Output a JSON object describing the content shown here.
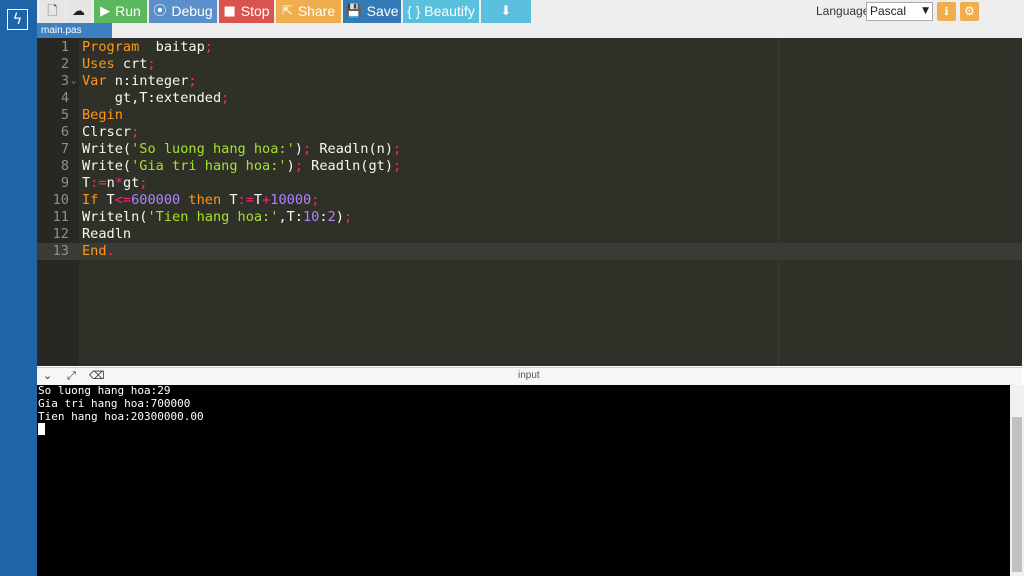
{
  "toolbar": {
    "new_icon": "🗋",
    "upload_icon": "☁",
    "run_label": "Run",
    "run_icon": "▶",
    "debug_label": "Debug",
    "debug_icon": "⦿",
    "stop_label": "Stop",
    "stop_icon": "■",
    "share_label": "Share",
    "share_icon": "⇱",
    "save_label": "Save",
    "save_icon": "💾",
    "beautify_label": "{ } Beautify",
    "download_icon": "⬇",
    "language_label": "Language",
    "language_value": "Pascal",
    "info_icon": "ℹ",
    "settings_icon": "⚙"
  },
  "tabs": [
    {
      "label": "main.pas",
      "active": true
    }
  ],
  "editor": {
    "active_line": 13,
    "lines": [
      {
        "n": "1",
        "fold": "",
        "tokens": [
          [
            "kw",
            "Program"
          ],
          [
            "",
            "  baitap"
          ],
          [
            "punc",
            ";"
          ]
        ]
      },
      {
        "n": "2",
        "fold": "",
        "tokens": [
          [
            "kw",
            "Uses"
          ],
          [
            "",
            " crt"
          ],
          [
            "punc",
            ";"
          ]
        ]
      },
      {
        "n": "3",
        "fold": "⌄",
        "tokens": [
          [
            "kw",
            "Var"
          ],
          [
            "",
            " n:integer"
          ],
          [
            "punc",
            ";"
          ]
        ]
      },
      {
        "n": "4",
        "fold": "",
        "tokens": [
          [
            "",
            "    gt,T:extended"
          ],
          [
            "punc",
            ";"
          ]
        ]
      },
      {
        "n": "5",
        "fold": "",
        "tokens": [
          [
            "kw",
            "Begin"
          ]
        ]
      },
      {
        "n": "6",
        "fold": "",
        "tokens": [
          [
            "",
            "Clrscr"
          ],
          [
            "punc",
            ";"
          ]
        ]
      },
      {
        "n": "7",
        "fold": "",
        "tokens": [
          [
            "",
            "Write("
          ],
          [
            "str",
            "'So luong hang hoa:'"
          ],
          [
            "",
            ")"
          ],
          [
            "punc",
            ";"
          ],
          [
            "",
            " Readln(n)"
          ],
          [
            "punc",
            ";"
          ]
        ]
      },
      {
        "n": "8",
        "fold": "",
        "tokens": [
          [
            "",
            "Write("
          ],
          [
            "str",
            "'Gia tri hang hoa:'"
          ],
          [
            "",
            ")"
          ],
          [
            "punc",
            ";"
          ],
          [
            "",
            " Readln(gt)"
          ],
          [
            "punc",
            ";"
          ]
        ]
      },
      {
        "n": "9",
        "fold": "",
        "tokens": [
          [
            "",
            "T"
          ],
          [
            "op",
            ":="
          ],
          [
            "",
            "n"
          ],
          [
            "op",
            "*"
          ],
          [
            "",
            "gt"
          ],
          [
            "punc",
            ";"
          ]
        ]
      },
      {
        "n": "10",
        "fold": "",
        "tokens": [
          [
            "kw",
            "If"
          ],
          [
            "",
            " T"
          ],
          [
            "op",
            "<="
          ],
          [
            "num",
            "600000"
          ],
          [
            "",
            " "
          ],
          [
            "kw",
            "then"
          ],
          [
            "",
            " T"
          ],
          [
            "op",
            ":="
          ],
          [
            "",
            "T"
          ],
          [
            "op",
            "+"
          ],
          [
            "num",
            "10000"
          ],
          [
            "punc",
            ";"
          ]
        ]
      },
      {
        "n": "11",
        "fold": "",
        "tokens": [
          [
            "",
            "Writeln("
          ],
          [
            "str",
            "'Tien hang hoa:'"
          ],
          [
            "",
            ",T:"
          ],
          [
            "num",
            "10"
          ],
          [
            "",
            ":"
          ],
          [
            "num",
            "2"
          ],
          [
            "",
            ")"
          ],
          [
            "punc",
            ";"
          ]
        ]
      },
      {
        "n": "12",
        "fold": "",
        "tokens": [
          [
            "",
            "Readln"
          ]
        ]
      },
      {
        "n": "13",
        "fold": "",
        "tokens": [
          [
            "kw",
            "End"
          ],
          [
            "punc",
            "."
          ]
        ]
      }
    ]
  },
  "output_bar": {
    "collapse_icon": "⌄",
    "expand_icon": "⤢",
    "clear_icon": "⌫",
    "input_label": "input"
  },
  "console": {
    "lines": [
      "So luong hang hoa:29",
      "Gia tri hang hoa:700000",
      "Tien hang hoa:20300000.00"
    ]
  },
  "colors": {
    "sidebar": "#1f64a8",
    "editor_bg": "#2f3129",
    "keyword": "#fd971f",
    "string": "#a6e22e",
    "number": "#ae81ff"
  }
}
